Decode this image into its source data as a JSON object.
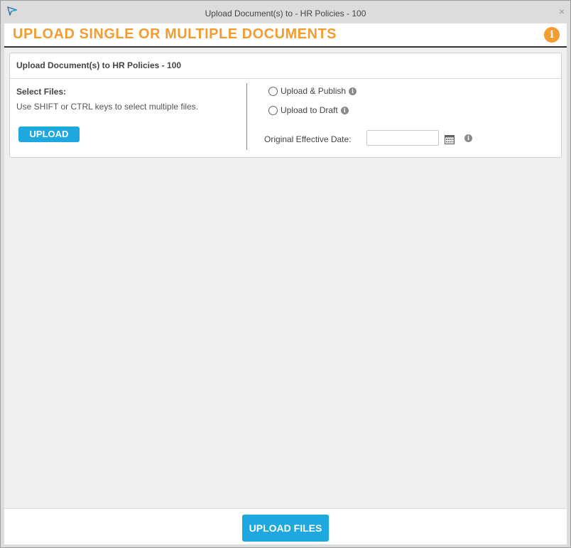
{
  "window": {
    "title": "Upload Document(s) to - HR Policies - 100",
    "close_glyph": "×",
    "logo_icon": "app-logo-icon"
  },
  "header": {
    "title": "UPLOAD SINGLE OR MULTIPLE DOCUMENTS",
    "info_glyph": "i",
    "accent_color": "#f39c32"
  },
  "panel": {
    "title": "Upload Document(s) to HR Policies - 100",
    "select_files_label": "Select Files:",
    "select_files_hint": "Use SHIFT or CTRL keys to select multiple files.",
    "upload_button": "UPLOAD",
    "options": [
      {
        "label": "Upload & Publish",
        "selected": false
      },
      {
        "label": "Upload to Draft",
        "selected": false
      }
    ],
    "date_label": "Original Effective Date:",
    "date_value": "",
    "info_glyph": "i"
  },
  "footer": {
    "upload_files_button": "UPLOAD FILES",
    "button_color": "#1ea8e0"
  }
}
